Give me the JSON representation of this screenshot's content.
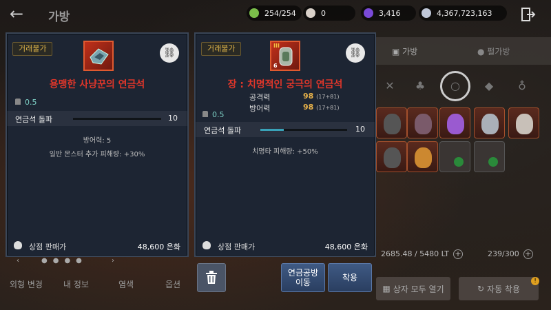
{
  "header": {
    "title": "가방",
    "currencies": [
      {
        "icon": "energy-icon",
        "value": "254/254",
        "color": "#7bbf4a"
      },
      {
        "icon": "pearl-icon",
        "value": "0",
        "color": "#d8d0c8"
      },
      {
        "icon": "purple-crystal-icon",
        "value": "3,416",
        "color": "#7a4ad8"
      },
      {
        "icon": "silver-coin-icon",
        "value": "4,367,723,163",
        "color": "#c0c8d8"
      }
    ]
  },
  "inventory": {
    "tabs": [
      "가방",
      "펄가방"
    ],
    "weight": "2685.48 / 5480 LT",
    "slots": "239/300",
    "open_all": "상자 모두 열기",
    "auto_equip": "자동 착용",
    "auto_equip_badge": "!",
    "bottom_tabs": [
      "외형 변경",
      "내 정보",
      "염색",
      "옵션"
    ]
  },
  "left_panel": {
    "trade_tag": "거래불가",
    "item_name": "용맹한 사냥꾼의 연금석",
    "weight": "0.5",
    "break_label": "연금석 돌파",
    "break_value": "10",
    "break_progress": 0,
    "effects": [
      "방어력: 5",
      "일반 몬스터 추가 피해량: +30%"
    ],
    "price_label": "상점 판매가",
    "price_value": "48,600 은화"
  },
  "right_panel": {
    "trade_tag": "거래불가",
    "item_name": "장 : 치명적인 궁극의 연금석",
    "stats": [
      {
        "label": "공격력",
        "value": "98",
        "sub": "(17+81)"
      },
      {
        "label": "방어력",
        "value": "98",
        "sub": "(17+81)"
      }
    ],
    "weight": "0.5",
    "break_label": "연금석 돌파",
    "break_value": "10",
    "break_progress": 0.27,
    "effects": [
      "치명타 피해량: +50%"
    ],
    "price_label": "상점 판매가",
    "price_value": "48,600 은화",
    "icon_grade": "III",
    "icon_badge": "6"
  },
  "actions": {
    "move_label": "연금공방\n이동",
    "move_line1": "연금공방",
    "move_line2": "이동",
    "equip_label": "착용"
  }
}
